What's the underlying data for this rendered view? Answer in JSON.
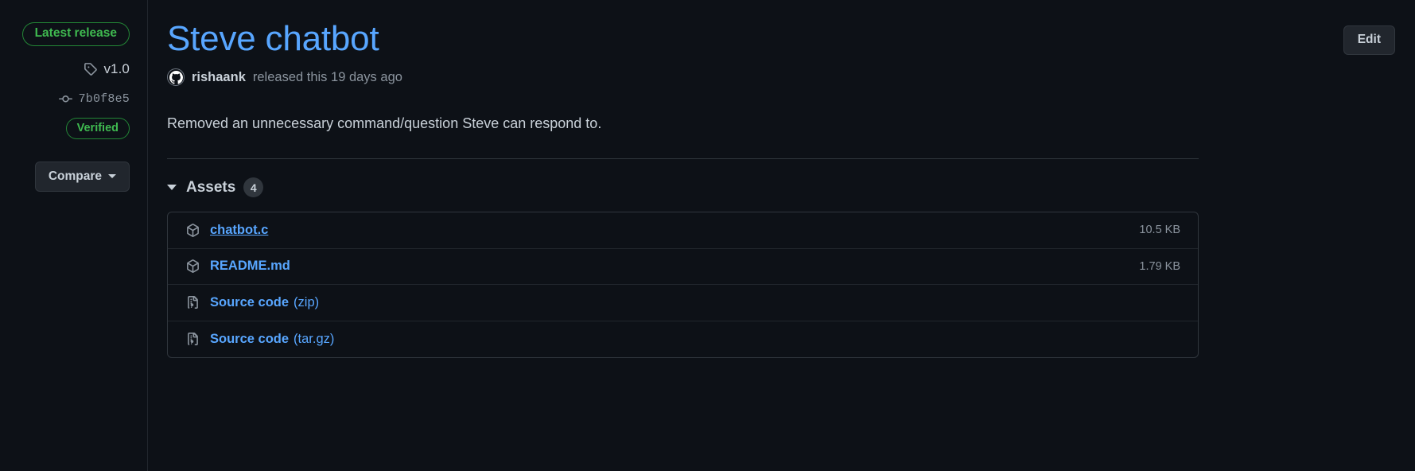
{
  "sidebar": {
    "latest_release_label": "Latest release",
    "tag": {
      "icon": "tag-icon",
      "value": "v1.0"
    },
    "commit": {
      "icon": "git-commit-icon",
      "value": "7b0f8e5"
    },
    "verified_label": "Verified",
    "compare_label": "Compare",
    "compare_caret_icon": "chevron-down-icon"
  },
  "header": {
    "title": "Steve chatbot",
    "edit_label": "Edit"
  },
  "byline": {
    "avatar_icon": "github-avatar-icon",
    "author": "rishaank",
    "text": "released this 19 days ago"
  },
  "body": {
    "description": "Removed an unnecessary command/question Steve can respond to."
  },
  "assets": {
    "caret_icon": "triangle-down-icon",
    "title": "Assets",
    "count": "4",
    "rows": [
      {
        "icon": "package-icon",
        "name": "chatbot.c",
        "suffix": "",
        "size": "10.5 KB",
        "hovered": true
      },
      {
        "icon": "package-icon",
        "name": "README.md",
        "suffix": "",
        "size": "1.79 KB",
        "hovered": false
      },
      {
        "icon": "file-zip-icon",
        "name": "Source code",
        "suffix": "(zip)",
        "size": "",
        "hovered": false
      },
      {
        "icon": "file-zip-icon",
        "name": "Source code",
        "suffix": "(tar.gz)",
        "size": "",
        "hovered": false
      }
    ]
  },
  "colors": {
    "background": "#0d1117",
    "link": "#58a6ff",
    "green": "#3fb950",
    "border": "#30363d",
    "muted": "#8b949e"
  }
}
